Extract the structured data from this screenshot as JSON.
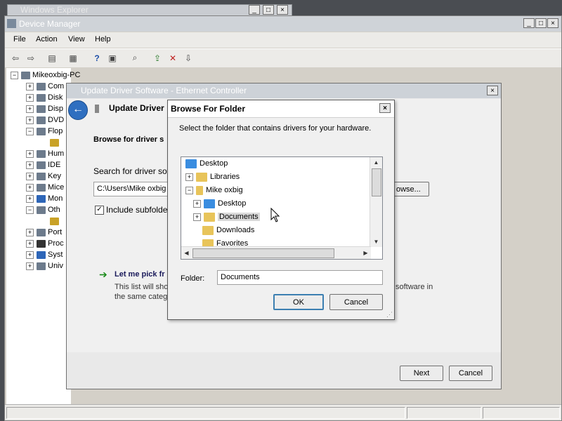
{
  "background_window": {
    "title": "Windows Explorer"
  },
  "device_manager": {
    "title": "Device Manager",
    "menu": [
      "File",
      "Action",
      "View",
      "Help"
    ],
    "toolbar_icons": [
      "back-icon",
      "forward-icon",
      "show-hide-tree-icon",
      "properties-icon",
      "help-icon",
      "properties-pane-icon",
      "scan-hardware-icon",
      "update-driver-icon",
      "uninstall-icon",
      "disable-icon"
    ],
    "root": "Mikeoxbig-PC",
    "tree_items": [
      "Com",
      "Disk",
      "Disp",
      "DVD",
      "Flop",
      "",
      "Hum",
      "IDE",
      "Key",
      "Mice",
      "Mon",
      "Oth",
      "",
      "Port",
      "Proc",
      "Syst",
      "Univ"
    ]
  },
  "update_wizard": {
    "title": "Update Driver Software - Ethernet Controller",
    "header": "Update Driver",
    "browse_heading": "Browse for driver s",
    "search_label": "Search for driver sof",
    "path_value": "C:\\Users\\Mike oxbig",
    "browse_button": "owse...",
    "include_subfolders": "Include subfolde",
    "let_me_pick": "Let me pick fr",
    "desc_line1": "This list will show",
    "desc_line1_tail": "software in",
    "desc_line2": "the same categ",
    "next_button": "Next",
    "cancel_button": "Cancel"
  },
  "browse_dialog": {
    "title": "Browse For Folder",
    "instruction": "Select the folder that contains drivers for your hardware.",
    "tree": [
      {
        "label": "Desktop",
        "level": 0
      },
      {
        "label": "Libraries",
        "level": 1
      },
      {
        "label": "Mike oxbig",
        "level": 1
      },
      {
        "label": "Desktop",
        "level": 2
      },
      {
        "label": "Documents",
        "level": 2
      },
      {
        "label": "Downloads",
        "level": 2
      },
      {
        "label": "Favorites",
        "level": 2
      }
    ],
    "folder_label": "Folder:",
    "folder_value": "Documents",
    "ok_button": "OK",
    "cancel_button": "Cancel",
    "selected": "Documents"
  }
}
